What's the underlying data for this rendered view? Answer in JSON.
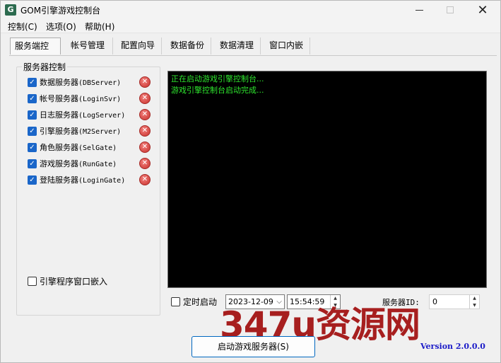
{
  "window": {
    "title": "GOM引擎游戏控制台",
    "icon_name": "app-logo-icon"
  },
  "menu": {
    "items": [
      {
        "label": "控制(C)"
      },
      {
        "label": "选项(O)"
      },
      {
        "label": "帮助(H)"
      }
    ]
  },
  "tabs": [
    {
      "label": "服务端控制",
      "active": true
    },
    {
      "label": "帐号管理",
      "active": false
    },
    {
      "label": "配置向导",
      "active": false
    },
    {
      "label": "数据备份",
      "active": false
    },
    {
      "label": "数据清理",
      "active": false
    },
    {
      "label": "窗口内嵌",
      "active": false
    }
  ],
  "server_group": {
    "title": "服务器控制",
    "servers": [
      {
        "name": "数据服务器",
        "code": "(DBServer)",
        "checked": true
      },
      {
        "name": "帐号服务器",
        "code": "(LoginSvr)",
        "checked": true
      },
      {
        "name": "日志服务器",
        "code": "(LogServer)",
        "checked": true
      },
      {
        "name": "引擎服务器",
        "code": "(M2Server)",
        "checked": true
      },
      {
        "name": "角色服务器",
        "code": "(SelGate)",
        "checked": true
      },
      {
        "name": "游戏服务器",
        "code": "(RunGate)",
        "checked": true
      },
      {
        "name": "登陆服务器",
        "code": "(LoginGate)",
        "checked": true
      }
    ],
    "embed_label": "引擎程序窗口嵌入",
    "embed_checked": false
  },
  "console": {
    "lines": [
      "正在启动游戏引擎控制台...",
      "游戏引擎控制台启动完成..."
    ],
    "text_color": "#2ee62e"
  },
  "schedule": {
    "auto_start_label": "定时启动",
    "auto_start_checked": false,
    "date": "2023-12-09",
    "time": "15:54:59"
  },
  "server_id": {
    "label": "服务器ID:",
    "value": "0"
  },
  "start_button": {
    "label": "启动游戏服务器(S)"
  },
  "version": "Version 2.0.0.0",
  "watermark": "347u资源网",
  "colors": {
    "accent": "#0067c0",
    "checkbox": "#1a66c9",
    "stop_red": "#c9302c",
    "version_blue": "#1c1cc8"
  }
}
